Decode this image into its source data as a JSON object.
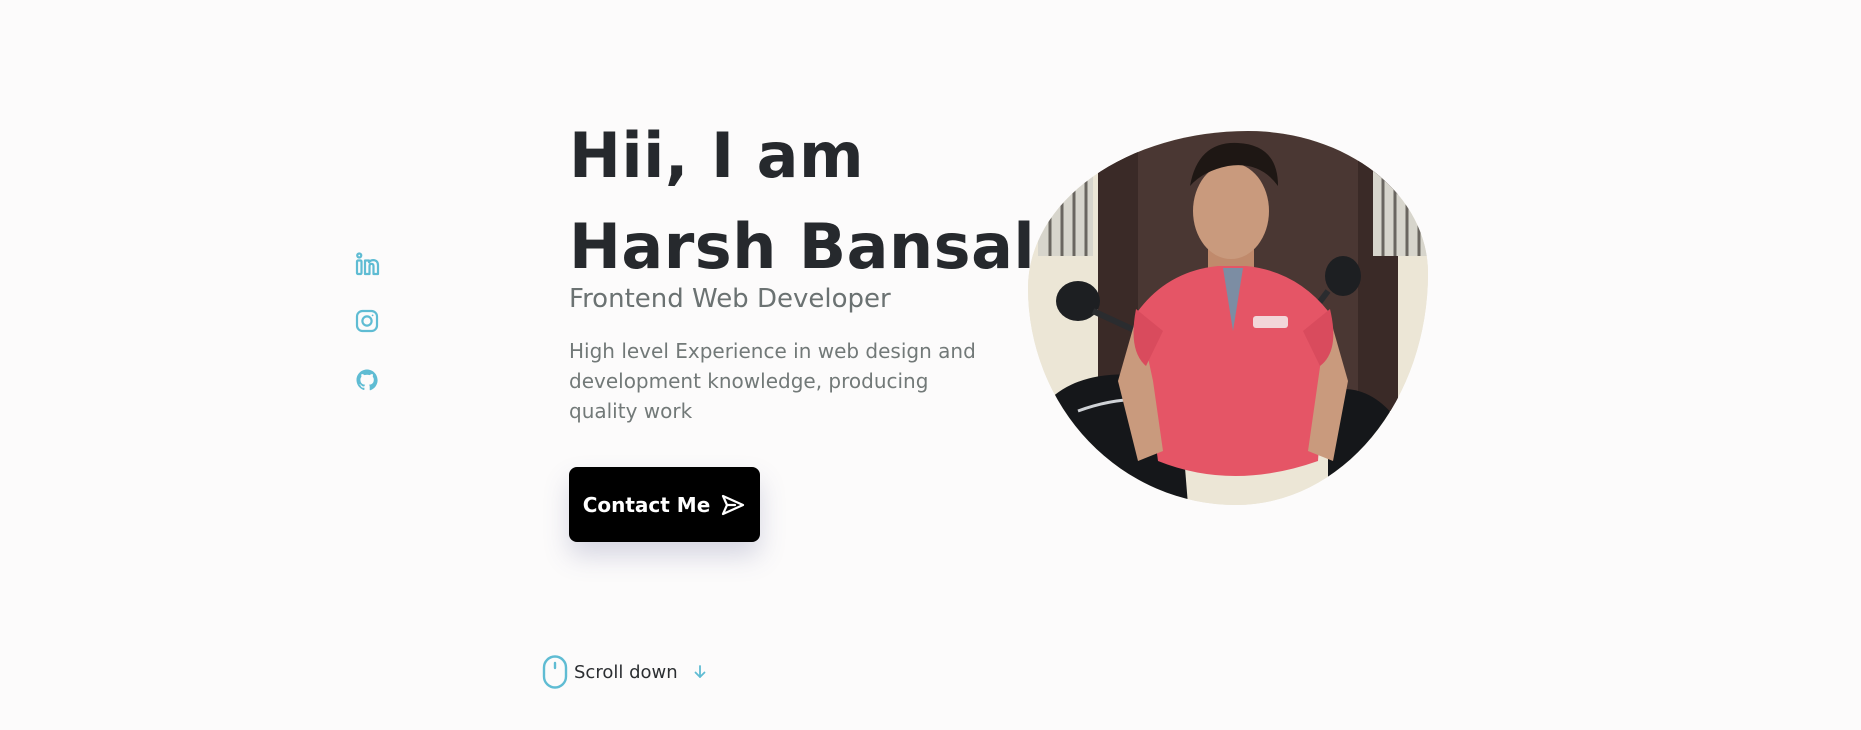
{
  "social": {
    "items": [
      {
        "icon": "linkedin-icon"
      },
      {
        "icon": "instagram-icon"
      },
      {
        "icon": "github-icon"
      }
    ],
    "color": "#5fbcd3"
  },
  "hero": {
    "title_line1": "Hii, I am",
    "title_line2": "Harsh Bansal",
    "subtitle": "Frontend Web Developer",
    "description": "High level Experience in web design and development knowledge, producing quality work",
    "contact_button_label": "Contact Me",
    "contact_button_icon": "send-icon"
  },
  "scroll": {
    "label": "Scroll down",
    "mouse_icon": "mouse-icon",
    "arrow_icon": "arrow-down-icon"
  },
  "colors": {
    "accent": "#5fbcd3",
    "text_dark": "#26292d",
    "text_muted": "#727978",
    "button_bg": "#000000",
    "page_bg": "#fcfbfb"
  }
}
